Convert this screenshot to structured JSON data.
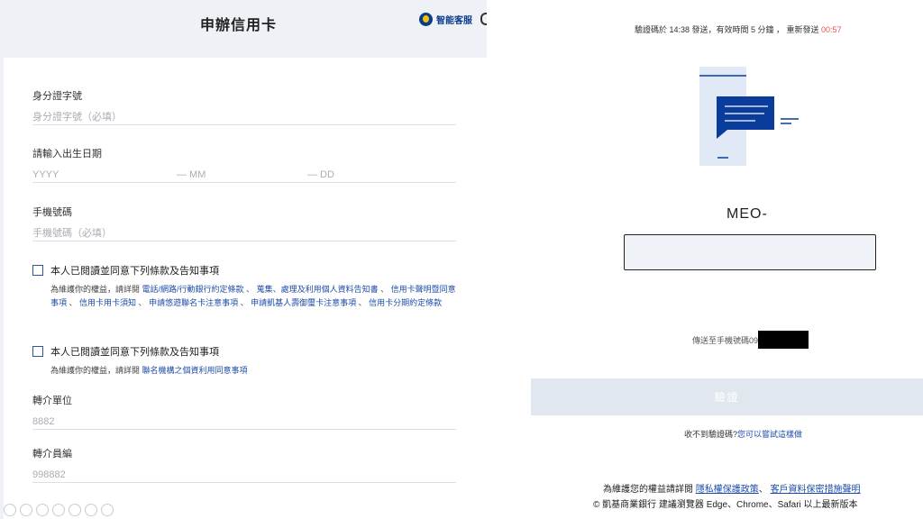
{
  "left": {
    "header": {
      "title": "申辦信用卡",
      "service_label": "智能客服"
    },
    "fields": {
      "id_number": {
        "label": "身分證字號",
        "placeholder": "身分證字號（必填）"
      },
      "birthdate": {
        "label": "請輸入出生日期",
        "year": "YYYY",
        "month": "— MM",
        "day": "— DD"
      },
      "phone": {
        "label": "手機號碼",
        "placeholder": "手機號碼（必填）"
      },
      "referral_unit": {
        "label": "轉介單位",
        "value": "8882"
      },
      "referral_staff": {
        "label": "轉介員編",
        "value": "998882"
      }
    },
    "consent1": {
      "title": "本人已閱讀並同意下列條款及告知事項",
      "intro": "為維護你的權益，請詳閱",
      "links": [
        "電話/網路/行動銀行約定條款",
        "蒐集、處理及利用個人資料告知書",
        "信用卡聲明暨同意事項",
        "信用卡用卡須知",
        "申請悠遊聯名卡注意事項",
        "申請凱基人壽御璽卡注意事項",
        "信用卡分期約定條款"
      ],
      "separator": " 、 "
    },
    "consent2": {
      "title": "本人已閱讀並同意下列條款及告知事項",
      "intro": "為維護你的權益，請詳閱",
      "link": "聯名機構之個資利用同意事項"
    }
  },
  "right": {
    "otp_info": {
      "prefix": "驗證碼於 14:38 發送，有效時間 5 分鐘 ， 重新發送 ",
      "countdown": "00:57"
    },
    "code_prefix": "MEO-",
    "sent_to": "傳送至手機號碼09",
    "verify_label": "驗證",
    "no_code": {
      "text": "收不到驗證碼?",
      "link": "您可以嘗試這樣做"
    },
    "footer": {
      "intro": "為維護您的權益請詳閱 ",
      "privacy_link": "隱私權保護政策",
      "sep": "、 ",
      "security_link": "客戶資料保密措施聲明",
      "copyright": "© 凱基商業銀行 建議瀏覽器 Edge、Chrome、Safari 以上最新版本"
    }
  },
  "colors": {
    "accent": "#1e4da8",
    "countdown": "#e25a4a",
    "button_disabled": "#e1e7ee",
    "illustration_blue": "#0a3c9c"
  }
}
